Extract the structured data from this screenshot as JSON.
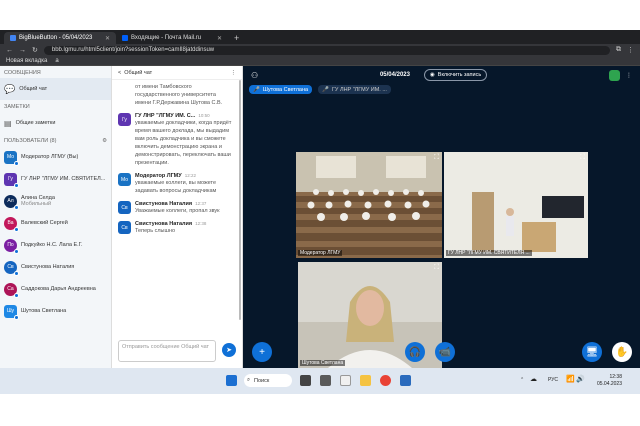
{
  "browser": {
    "tabs": [
      {
        "label": "BigBlueButton - 05/04/2023",
        "active": true
      },
      {
        "label": "Входящие - Почта Mail.ru",
        "active": false
      }
    ],
    "new_tab": "+",
    "url": "bbb.lgmu.ru/html5client/join?sessionToken=camIl8jatddinsuw",
    "bookmarks": [
      "Новая вкладка",
      "a"
    ]
  },
  "sidebar": {
    "messages_title": "СООБЩЕНИЯ",
    "public_chat": "Общий чат",
    "notes_title": "ЗАМЕТКИ",
    "shared_notes": "Общие заметки",
    "users_title": "ПОЛЬЗОВАТЕЛИ (8)",
    "users": [
      {
        "initials": "Мо",
        "name": "Модератор ЛГМУ (Вы)",
        "color": "#1a73c4",
        "shape": "square"
      },
      {
        "initials": "Гу",
        "name": "ГУ ЛНР \"ЛГМУ ИМ. СВЯТИТЕЛ...",
        "color": "#5e35b1",
        "shape": "square"
      },
      {
        "initials": "Ал",
        "name": "Алина Селда",
        "sub": "Мобильный",
        "color": "#0d2c5c",
        "shape": "round"
      },
      {
        "initials": "Ва",
        "name": "Валевский Сергей",
        "color": "#c2185b",
        "shape": "round"
      },
      {
        "initials": "По",
        "name": "Подкуйко Н.С. Лала Е.Г.",
        "color": "#7b1fa2",
        "shape": "round"
      },
      {
        "initials": "Св",
        "name": "Свистунова Наталия",
        "color": "#1565c0",
        "shape": "round"
      },
      {
        "initials": "Са",
        "name": "Саддокова Дарья Андреевна",
        "color": "#ad1457",
        "shape": "round"
      },
      {
        "initials": "Шу",
        "name": "Шутова Светлана",
        "color": "#1e88e5",
        "shape": "square"
      }
    ]
  },
  "chat": {
    "title": "Общий чат",
    "back": "<",
    "menu": "⋮",
    "top_text": "от имени Тамбовского государственного университета имени Г.Р.Державина Шутова С.В.",
    "messages": [
      {
        "initials": "Гу",
        "color": "#5e35b1",
        "name": "ГУ ЛНР \"ЛГМУ ИМ. С...",
        "time": "10:50",
        "text": "уважаемые докладчики, когда придёт время вашего доклада, мы выдадим вам роль докладчика и вы сможете включить демонстрацию экрана и демонстрировать, переключать ваши презентации."
      },
      {
        "initials": "Мо",
        "color": "#1a73c4",
        "name": "Модератор ЛГМУ",
        "time": "12:22",
        "text": "уважаемые коллеги, вы можете задавать вопросы докладчикам"
      },
      {
        "initials": "Св",
        "color": "#1565c0",
        "name": "Свистунова Наталия",
        "time": "12:37",
        "text": "Уважаемые коллеги, пропал звук"
      },
      {
        "initials": "Св",
        "color": "#1565c0",
        "name": "Свистунова Наталия",
        "time": "12:38",
        "text": "Теперь слышно"
      }
    ],
    "input_placeholder": "Отправить сообщение Общий чат",
    "send": "➤"
  },
  "main": {
    "date": "05/04/2023",
    "record": "Включить запись",
    "chips": [
      "Шутова Светлана",
      "ГУ ЛНР \"ЛГМУ ИМ. ..."
    ],
    "videos": [
      {
        "label": "Модератор ЛГМУ"
      },
      {
        "label": "ГУ ЛНР \"ЛГМУ ИМ. СВЯТИТЕЛЯ ..."
      },
      {
        "label": "Шутова Светлана"
      }
    ]
  },
  "taskbar": {
    "search": "Поиск",
    "lang": "РУС",
    "time": "12:38",
    "date": "05.04.2023"
  }
}
